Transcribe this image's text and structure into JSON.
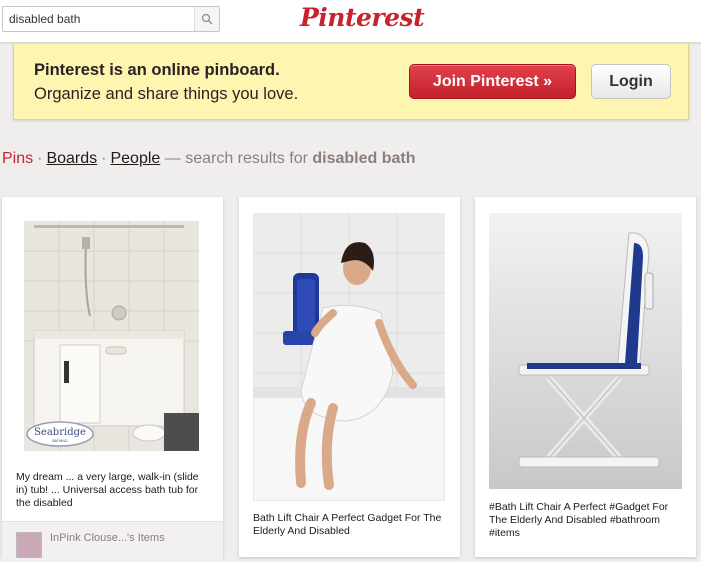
{
  "search": {
    "value": "disabled bath",
    "icon": "search-icon"
  },
  "logo": "Pinterest",
  "banner": {
    "title": "Pinterest is an online pinboard.",
    "subtitle": "Organize and share things you love.",
    "join_label": "Join Pinterest »",
    "login_label": "Login"
  },
  "nav": {
    "pins": "Pins",
    "boards": "Boards",
    "people": "People",
    "results_prefix": "— search results for",
    "query": "disabled bath"
  },
  "pins": [
    {
      "description": "My dream ... a very large, walk-in (slide in) tub! ... Universal access bath tub for the disabled",
      "image_brand": "Seabridge",
      "image_brand_sub": "BATHING",
      "owner": "InPink Clouse...'s Items"
    },
    {
      "description": "Bath Lift Chair A Perfect Gadget For The Elderly And Disabled"
    },
    {
      "description": "#Bath Lift Chair A Perfect #Gadget For The Elderly And Disabled #bathroom #items"
    }
  ],
  "colors": {
    "brand_red": "#c8232c",
    "banner_yellow": "#fdf5b0",
    "page_bg": "#f0eded"
  }
}
